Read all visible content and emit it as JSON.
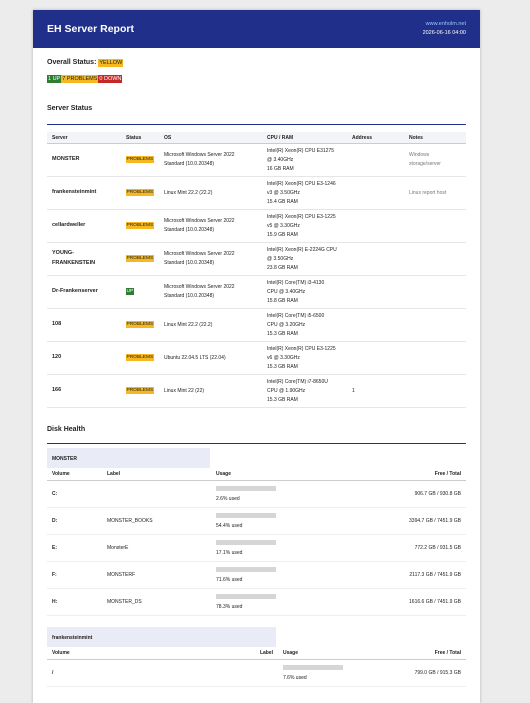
{
  "header": {
    "title": "EH Server Report",
    "site": "www.enholm.net",
    "date": "2026-06-16 04:00"
  },
  "overall": {
    "label": "Overall Status:",
    "status": "YELLOW"
  },
  "counts": {
    "up": "1 UP",
    "problems": "7 PROBLEMS",
    "down": "0 DOWN"
  },
  "server_status": {
    "title": "Server Status",
    "columns": [
      "Server",
      "Status",
      "OS",
      "CPU / RAM",
      "Address",
      "Notes"
    ],
    "rows": [
      {
        "server": "MONSTER",
        "status": "PROBLEMS",
        "os1": "Microsoft Windows Server 2022",
        "os2": "Standard (10.0.20348)",
        "cpu1": "Intel(R) Xeon(R) CPU E31275",
        "cpu2": "@ 3.40GHz",
        "cpu3": "16 GB RAM",
        "address": "",
        "notes1": "Windows",
        "notes2": "storage/server"
      },
      {
        "server": "frankensteinmint",
        "status": "PROBLEMS",
        "os1": "Linux Mint 22.2 (22.2)",
        "os2": "",
        "cpu1": "Intel(R) Xeon(R) CPU E3-1246",
        "cpu2": "v3 @ 3.50GHz",
        "cpu3": "15.4 GB RAM",
        "address": "",
        "notes1": "Linux report host",
        "notes2": ""
      },
      {
        "server": "cellardweller",
        "status": "PROBLEMS",
        "os1": "Microsoft Windows Server 2022",
        "os2": "Standard (10.0.20348)",
        "cpu1": "Intel(R) Xeon(R) CPU E3-1225",
        "cpu2": "v5 @ 3.30GHz",
        "cpu3": "15.9 GB RAM",
        "address": "",
        "notes1": "",
        "notes2": ""
      },
      {
        "server": "YOUNG-",
        "server2": "FRANKENSTEIN",
        "status": "PROBLEMS",
        "os1": "Microsoft Windows Server 2022",
        "os2": "Standard (10.0.20348)",
        "cpu1": "Intel(R) Xeon(R) E-2224G CPU",
        "cpu2": "@ 3.50GHz",
        "cpu3": "23.8 GB RAM",
        "address": "",
        "notes1": "",
        "notes2": ""
      },
      {
        "server": "Dr-Frankenserver",
        "status": "UP",
        "os1": "Microsoft Windows Server 2022",
        "os2": "Standard (10.0.20348)",
        "cpu1": "Intel(R) Core(TM) i3-4130",
        "cpu2": "CPU @ 3.40GHz",
        "cpu3": "15.8 GB RAM",
        "address": "",
        "notes1": "",
        "notes2": ""
      },
      {
        "server": "108",
        "status": "PROBLEMS",
        "os1": "Linux Mint 22.2 (22.2)",
        "os2": "",
        "cpu1": "Intel(R) Core(TM) i5-6500",
        "cpu2": "CPU @ 3.20GHz",
        "cpu3": "15.3 GB RAM",
        "address": "",
        "notes1": "",
        "notes2": ""
      },
      {
        "server": "120",
        "status": "PROBLEMS",
        "os1": "Ubuntu 22.04.5 LTS (22.04)",
        "os2": "",
        "cpu1": "Intel(R) Xeon(R) CPU E3-1225",
        "cpu2": "v6 @ 3.30GHz",
        "cpu3": "15.3 GB RAM",
        "address": "",
        "notes1": "",
        "notes2": ""
      },
      {
        "server": "166",
        "status": "PROBLEMS",
        "os1": "Linux Mint 22 (22)",
        "os2": "",
        "cpu1": "Intel(R) Core(TM) i7-8650U",
        "cpu2": "CPU @ 1.90GHz",
        "cpu3": "15.3 GB RAM",
        "address": "1",
        "notes1": "",
        "notes2": ""
      }
    ]
  },
  "disk_health": {
    "title": "Disk Health",
    "columns": [
      "Volume",
      "Label",
      "Usage",
      "Free / Total"
    ],
    "monster": {
      "name": "MONSTER",
      "rows": [
        {
          "volume": "C:",
          "label": "",
          "pct": 2.6,
          "used": "2.6% used",
          "free": "906.7 GB / 930.8 GB"
        },
        {
          "volume": "D:",
          "label": "MONSTER_BOOKS",
          "pct": 54.4,
          "used": "54.4% used",
          "free": "3394.7 GB / 7451.9 GB"
        },
        {
          "volume": "E:",
          "label": "MonsterE",
          "pct": 17.1,
          "used": "17.1% used",
          "free": "772.2 GB / 931.5 GB"
        },
        {
          "volume": "F:",
          "label": "MONSTERF",
          "pct": 71.6,
          "used": "71.6% used",
          "free": "2117.3 GB / 7451.9 GB"
        },
        {
          "volume": "H:",
          "label": "MONSTER_DS",
          "pct": 78.3,
          "used": "78.3% used",
          "free": "1616.6 GB / 7451.9 GB"
        }
      ]
    },
    "frank": {
      "name": "frankensteinmint",
      "rows": [
        {
          "volume": "/",
          "label": "",
          "pct": 7.6,
          "used": "7.6% used",
          "free": "799.0 GB / 915.3 GB"
        }
      ]
    }
  }
}
